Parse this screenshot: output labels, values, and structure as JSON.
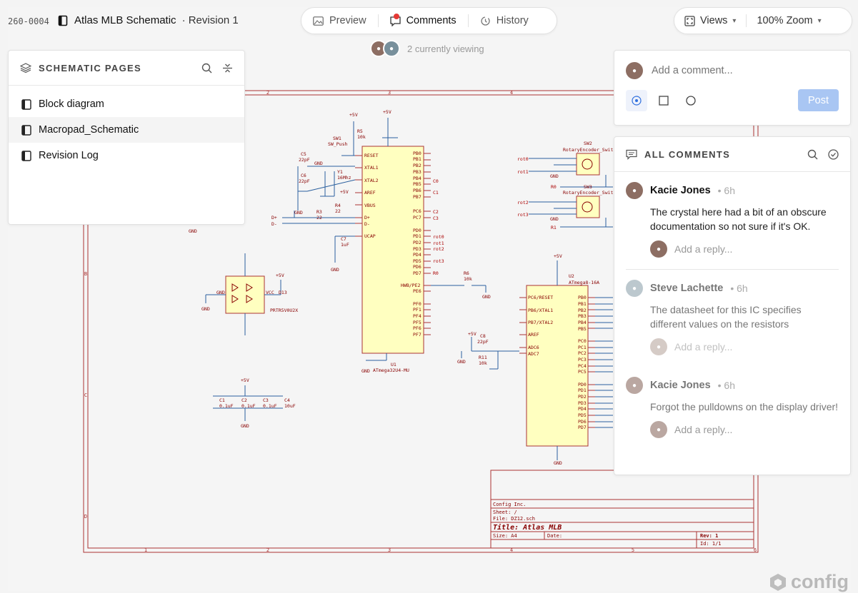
{
  "doc": {
    "id": "260-0004",
    "title": "Atlas MLB Schematic",
    "revision": "· Revision 1"
  },
  "tabs": [
    {
      "label": "Preview"
    },
    {
      "label": "Comments"
    },
    {
      "label": "History"
    }
  ],
  "controls": {
    "views": "Views",
    "zoom": "100% Zoom"
  },
  "viewers": {
    "text": "2 currently viewing"
  },
  "pages_panel": {
    "title": "SCHEMATIC PAGES",
    "items": [
      {
        "label": "Block diagram"
      },
      {
        "label": "Macropad_Schematic"
      },
      {
        "label": "Revision Log"
      }
    ]
  },
  "composer": {
    "placeholder": "Add a comment...",
    "post": "Post"
  },
  "comments_panel": {
    "title": "ALL COMMENTS",
    "reply_placeholder": "Add a reply...",
    "items": [
      {
        "author": "Kacie Jones",
        "time": "• 6h",
        "body": "The crystal here had a bit of an obscure documentation so not sure if it's OK.",
        "resolved": false
      },
      {
        "author": "Steve Lachette",
        "time": "• 6h",
        "body": "The datasheet for this IC specifies different values on the resistors",
        "resolved": true
      },
      {
        "author": "Kacie Jones",
        "time": "• 6h",
        "body": "Forgot the pulldowns on the display driver!",
        "resolved": false
      }
    ]
  },
  "schematic": {
    "border_cols": [
      "1",
      "2",
      "3",
      "4",
      "5",
      "6"
    ],
    "border_rows": [
      "B",
      "C",
      "D"
    ],
    "u1": {
      "ref": "U1",
      "part": "ATmega32U4-MU",
      "left_pins": [
        "RESET",
        "XTAL1",
        "XTAL2",
        "AREF",
        "VBUS",
        "D+",
        "D-",
        "UCAP"
      ],
      "right_pins": [
        "PB0",
        "PB1",
        "PB2",
        "PB3",
        "PB4",
        "PB5",
        "PB6",
        "PB7",
        "PC6",
        "PC7",
        "PD0",
        "PD1",
        "PD2",
        "PD3",
        "PD4",
        "PD5",
        "PD6",
        "PD7",
        "HWB/PE2",
        "PE6",
        "PF0",
        "PF1",
        "PF4",
        "PF5",
        "PF6",
        "PF7"
      ]
    },
    "u2": {
      "ref": "U2",
      "part": "ATmega8-16A",
      "left_pins": [
        "PC6/RESET",
        "PB6/XTAL1",
        "PB7/XTAL2",
        "AREF",
        "ADC6",
        "ADC7"
      ],
      "right_pins": [
        "PB0",
        "PB1",
        "PB2",
        "PB3",
        "PB4",
        "PB5",
        "PC0",
        "PC1",
        "PC2",
        "PC3",
        "PC4",
        "PC5",
        "PD0",
        "PD1",
        "PD2",
        "PD3",
        "PD4",
        "PD5",
        "PD6",
        "PD7"
      ]
    },
    "nets": [
      "rot0",
      "rot1",
      "rot2",
      "rot3",
      "R0",
      "C0",
      "C1",
      "C2",
      "C3",
      "R1"
    ],
    "labels": {
      "p5v": "+5V",
      "gnd": "GND",
      "vcc": "VCC",
      "sw1": "SW1",
      "sw1v": "SW_Push",
      "r5": "R5",
      "r5v": "10k",
      "c5": "C5",
      "c5v": "22pF",
      "c6": "C6",
      "c6v": "22pF",
      "y1": "Y1",
      "y1v": "16Mhz",
      "r4": "R4",
      "r4v": "22",
      "r3": "R3",
      "r3v": "22",
      "c7": "C7",
      "c7v": "1uF",
      "r6": "R6",
      "r6v": "10k",
      "c8": "C8",
      "c8v": "22pF",
      "r11": "R11",
      "r11v": "10k",
      "d13": "D13",
      "d13v": "PRTR5V0U2X",
      "c1": "C1",
      "c1v": "0.1uF",
      "c2": "C2",
      "c2v": "0.1uF",
      "c3": "C3",
      "c3v": "0.1uF",
      "c4": "C4",
      "c4v": "10uF",
      "sw2": "SW2",
      "sw3": "SW3",
      "enc": "RotaryEncoder_Switch",
      "dp": "D+",
      "dm": "D-"
    },
    "title_block": {
      "company": "Config Inc.",
      "sheet": "Sheet: /",
      "file": "File: DZ12.sch",
      "title": "Title: Atlas MLB",
      "size": "Size: A4",
      "date": "Date:",
      "rev": "Rev: 1",
      "id": "Id: 1/1"
    }
  },
  "watermark": "config"
}
